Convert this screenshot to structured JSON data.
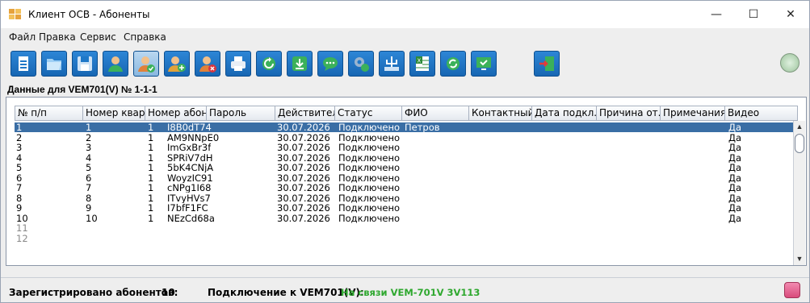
{
  "window": {
    "title": "Клиент ОСВ - Абоненты",
    "minimize": "—",
    "maximize": "☐",
    "close": "✕"
  },
  "menu": [
    "Файл",
    "Правка",
    "Сервис",
    "Справка"
  ],
  "toolbar": {
    "buttons": [
      "new-document",
      "open-folder",
      "save",
      "user",
      "user-check",
      "user-add",
      "user-remove",
      "print",
      "refresh",
      "download",
      "chat",
      "settings",
      "network",
      "excel",
      "sync",
      "monitor-check",
      "exit"
    ]
  },
  "caption": "Данные для VEM701(V) № 1-1-1",
  "table": {
    "columns": [
      "№ п/п",
      "Номер квар...",
      "Номер абон...",
      "Пароль",
      "Действител...",
      "Статус",
      "ФИО",
      "Контактный ...",
      "Дата подкл...",
      "Причина от...",
      "Примечания",
      "Видео"
    ],
    "rows": [
      [
        "1",
        "1",
        "1",
        "I8B0dT74",
        "30.07.2026",
        "Подключено",
        "Петров",
        "",
        "",
        "",
        "",
        "Да"
      ],
      [
        "2",
        "2",
        "1",
        "AM9NNpE0",
        "30.07.2026",
        "Подключено",
        "",
        "",
        "",
        "",
        "",
        "Да"
      ],
      [
        "3",
        "3",
        "1",
        "ImGxBr3f",
        "30.07.2026",
        "Подключено",
        "",
        "",
        "",
        "",
        "",
        "Да"
      ],
      [
        "4",
        "4",
        "1",
        "SPRiV7dH",
        "30.07.2026",
        "Подключено",
        "",
        "",
        "",
        "",
        "",
        "Да"
      ],
      [
        "5",
        "5",
        "1",
        "5bK4CNjA",
        "30.07.2026",
        "Подключено",
        "",
        "",
        "",
        "",
        "",
        "Да"
      ],
      [
        "6",
        "6",
        "1",
        "WoyzIC91",
        "30.07.2026",
        "Подключено",
        "",
        "",
        "",
        "",
        "",
        "Да"
      ],
      [
        "7",
        "7",
        "1",
        "cNPg1I68",
        "30.07.2026",
        "Подключено",
        "",
        "",
        "",
        "",
        "",
        "Да"
      ],
      [
        "8",
        "8",
        "1",
        "ITvyHVs7",
        "30.07.2026",
        "Подключено",
        "",
        "",
        "",
        "",
        "",
        "Да"
      ],
      [
        "9",
        "9",
        "1",
        "I7bfF1FC",
        "30.07.2026",
        "Подключено",
        "",
        "",
        "",
        "",
        "",
        "Да"
      ],
      [
        "10",
        "10",
        "1",
        "NEzCd68a",
        "30.07.2026",
        "Подключено",
        "",
        "",
        "",
        "",
        "",
        "Да"
      ],
      [
        "11",
        "",
        "",
        "",
        "",
        "",
        "",
        "",
        "",
        "",
        "",
        ""
      ],
      [
        "12",
        "",
        "",
        "",
        "",
        "",
        "",
        "",
        "",
        "",
        "",
        ""
      ]
    ],
    "selected_row": 0
  },
  "status": {
    "registered_label": "Зарегистрировано абонентов:",
    "registered_count": "10",
    "connection_label": "Подключение к VEM701(V):",
    "connection_value": "На связи VEM-701V 3V113"
  },
  "colors": {
    "selection": "#3a6ea5",
    "toolbar_blue": "#1f78c8",
    "status_green": "#2fa82f"
  }
}
